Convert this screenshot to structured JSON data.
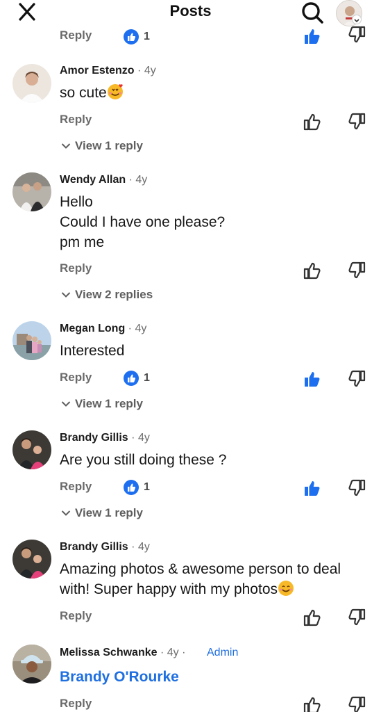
{
  "header": {
    "title": "Posts",
    "icons": {
      "close": "close-icon",
      "search": "search-icon",
      "profile": "profile-avatar"
    }
  },
  "top_row": {
    "reply_label": "Reply",
    "like_count": "1"
  },
  "comments": [
    {
      "author": "Amor Estenzo",
      "time": "4y",
      "body": [
        "so cute"
      ],
      "emoji": "smiling-face-with-hearts",
      "reply_label": "Reply",
      "like_count": "",
      "upvoted": false,
      "view_replies": "View 1 reply"
    },
    {
      "author": "Wendy Allan",
      "time": "4y",
      "body": [
        "Hello",
        "Could I have one please?",
        "pm me"
      ],
      "reply_label": "Reply",
      "like_count": "",
      "upvoted": false,
      "view_replies": "View 2 replies"
    },
    {
      "author": "Megan Long",
      "time": "4y",
      "body": [
        "Interested"
      ],
      "reply_label": "Reply",
      "like_count": "1",
      "upvoted": true,
      "view_replies": "View 1 reply"
    },
    {
      "author": "Brandy Gillis",
      "time": "4y",
      "body": [
        "Are you still doing these ?"
      ],
      "reply_label": "Reply",
      "like_count": "1",
      "upvoted": true,
      "view_replies": "View 1 reply"
    },
    {
      "author": "Brandy Gillis",
      "time": "4y",
      "body": [
        "Amazing photos & awesome person to deal",
        "with! Super happy with my photos"
      ],
      "emoji": "smiling-face",
      "reply_label": "Reply",
      "like_count": "",
      "upvoted": false,
      "view_replies": ""
    },
    {
      "author": "Melissa Schwanke",
      "time": "4y",
      "badge": "Admin",
      "body": [
        "Brandy O'Rourke"
      ],
      "mention": true,
      "reply_label": "Reply",
      "like_count": "",
      "upvoted": false,
      "view_replies": ""
    }
  ],
  "colors": {
    "accent": "#1d6ff0",
    "text": "#1c1c1c",
    "muted": "#6a6a6a"
  }
}
